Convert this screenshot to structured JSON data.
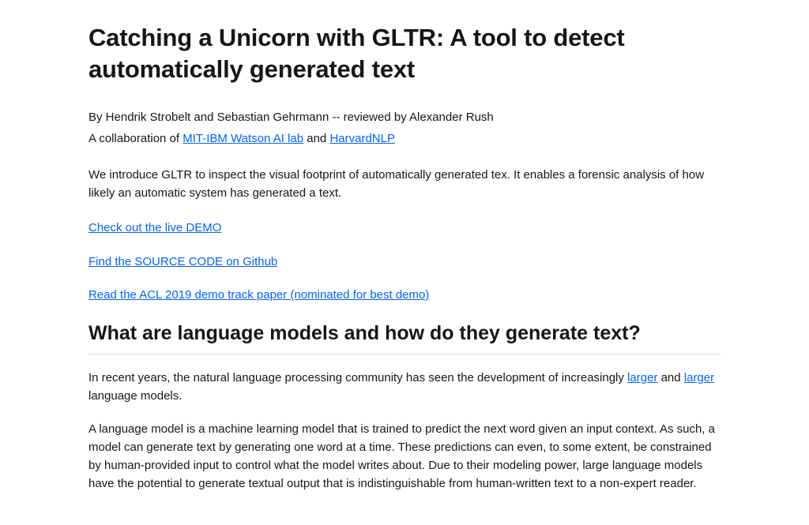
{
  "title": "Catching a Unicorn with GLTR: A tool to detect automatically generated text",
  "byline": "By Hendrik Strobelt and Sebastian Gehrmann -- reviewed by Alexander Rush",
  "collab_prefix": "A collaboration of ",
  "collab_link1": "MIT-IBM Watson AI lab",
  "collab_and": " and ",
  "collab_link2": "HarvardNLP",
  "intro": "We introduce GLTR to inspect the visual footprint of automatically generated tex. It enables a forensic analysis of how likely an automatic system has generated a text.",
  "links": {
    "demo": "Check out the live DEMO",
    "source": "Find the SOURCE CODE on Github",
    "paper": "Read the ACL 2019 demo track paper (nominated for best demo)"
  },
  "section_heading": "What are language models and how do they generate text?",
  "para1_prefix": "In recent years, the natural language processing community has seen the development of increasingly ",
  "para1_link1": "larger",
  "para1_and": " and ",
  "para1_link2": "larger",
  "para1_suffix": " language models.",
  "para2": "A language model is a machine learning model that is trained to predict the next word given an input context. As such, a model can generate text by generating one word at a time. These predictions can even, to some extent, be constrained by human-provided input to control what the model writes about. Due to their modeling power, large language models have the potential to generate textual output that is indistinguishable from human-written text to a non-expert reader."
}
